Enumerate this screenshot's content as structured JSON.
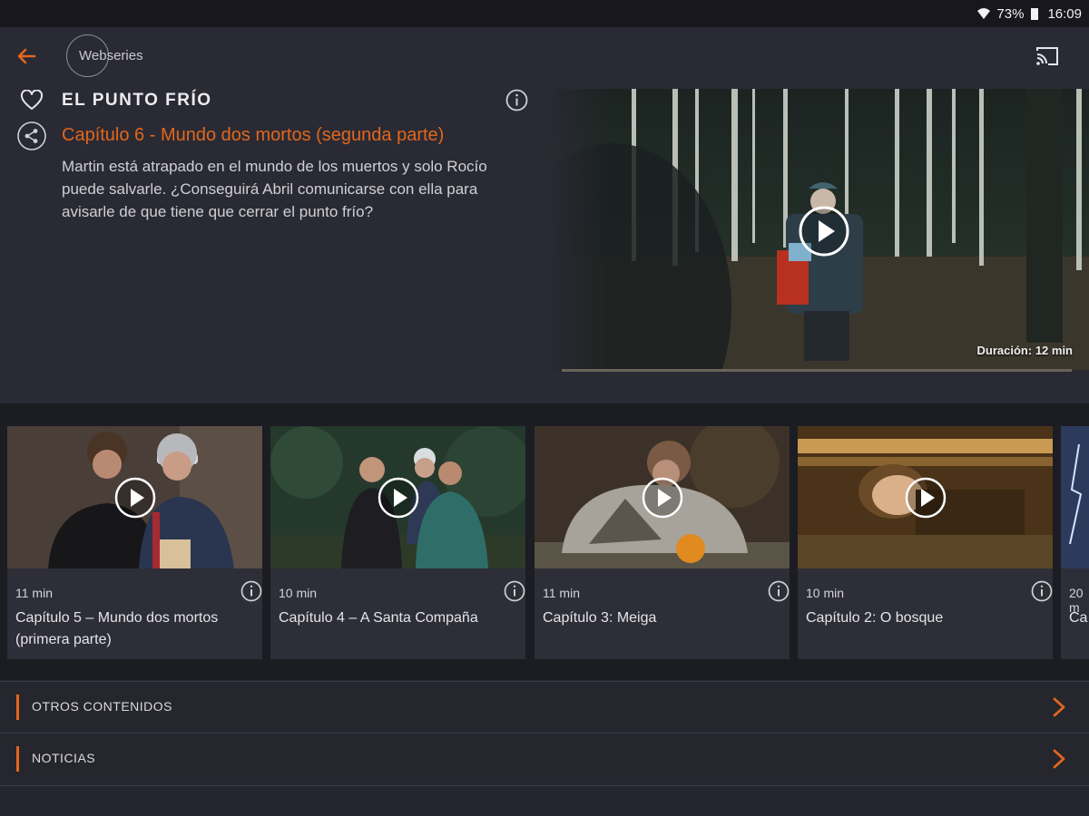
{
  "status_bar": {
    "battery": "73%",
    "time": "16:09"
  },
  "header": {
    "breadcrumb": "Webseries"
  },
  "series": {
    "title": "EL PUNTO FRÍO",
    "episode_title": "Capítulo 6 - Mundo dos mortos (segunda parte)",
    "description": "Martin está atrapado en el mundo de los muertos y solo Rocío puede salvarle. ¿Conseguirá Abril comunicarse con ella para avisarle de que tiene que cerrar el punto frío?"
  },
  "player": {
    "duration": "Duración: 12 min",
    "progress": 0
  },
  "episodes": [
    {
      "duration": "11 min",
      "title": "Capítulo 5 – Mundo dos mortos (primera parte)"
    },
    {
      "duration": "10 min",
      "title": "Capítulo 4 – A Santa Compaña"
    },
    {
      "duration": "11 min",
      "title": "Capítulo 3: Meiga"
    },
    {
      "duration": "10 min",
      "title": "Capítulo 2: O bosque"
    },
    {
      "duration": "20 m",
      "title": "Ca"
    }
  ],
  "sections": [
    {
      "label": "OTROS CONTENIDOS"
    },
    {
      "label": "NOTICIAS"
    }
  ],
  "colors": {
    "accent": "#e1671c",
    "background": "#252530"
  }
}
